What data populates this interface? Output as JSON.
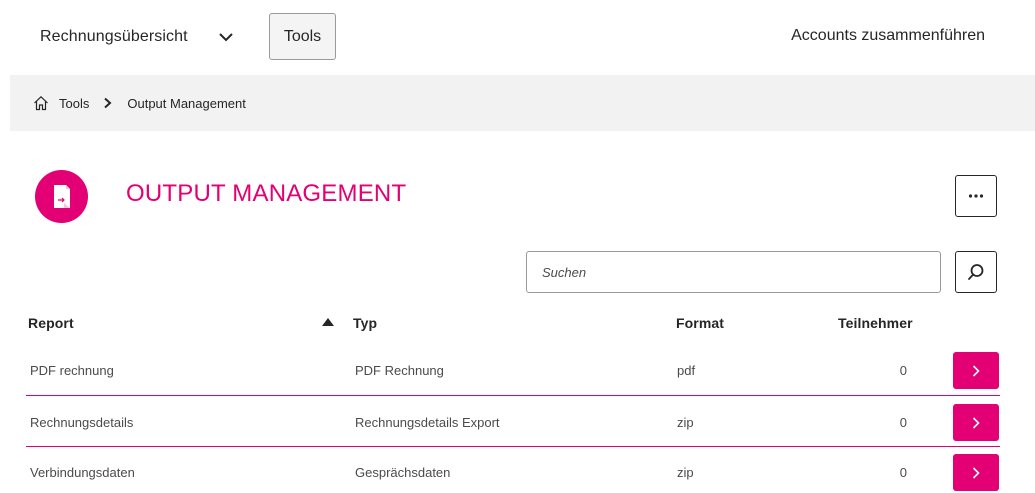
{
  "nav": {
    "select_label": "Rechnungsübersicht",
    "tools_label": "Tools",
    "accounts_label": "Accounts zusammenführen"
  },
  "breadcrumb": {
    "items": [
      "Tools",
      "Output Management"
    ]
  },
  "page": {
    "title": "OUTPUT MANAGEMENT",
    "accent_color": "#e20074"
  },
  "search": {
    "placeholder": "Suchen",
    "value": ""
  },
  "table": {
    "columns": [
      "Report",
      "Typ",
      "Format",
      "Teilnehmer"
    ],
    "sort": {
      "column": "Report",
      "direction": "ascending"
    },
    "rows": [
      {
        "report": "PDF rechnung",
        "typ": "PDF Rechnung",
        "format": "pdf",
        "teilnehmer": "0"
      },
      {
        "report": "Rechnungsdetails",
        "typ": "Rechnungsdetails Export",
        "format": "zip",
        "teilnehmer": "0"
      },
      {
        "report": "Verbindungsdaten",
        "typ": "Gesprächsdaten",
        "format": "zip",
        "teilnehmer": "0"
      }
    ]
  },
  "icons": {
    "nav_chevron": "chevron-down-icon",
    "home": "home-icon",
    "breadcrumb_sep": "chevron-right-icon",
    "page": "document-export-icon",
    "more": "more-horizontal-icon",
    "search": "search-icon",
    "sort": "sort-ascending-icon",
    "row_action": "chevron-right-icon"
  }
}
